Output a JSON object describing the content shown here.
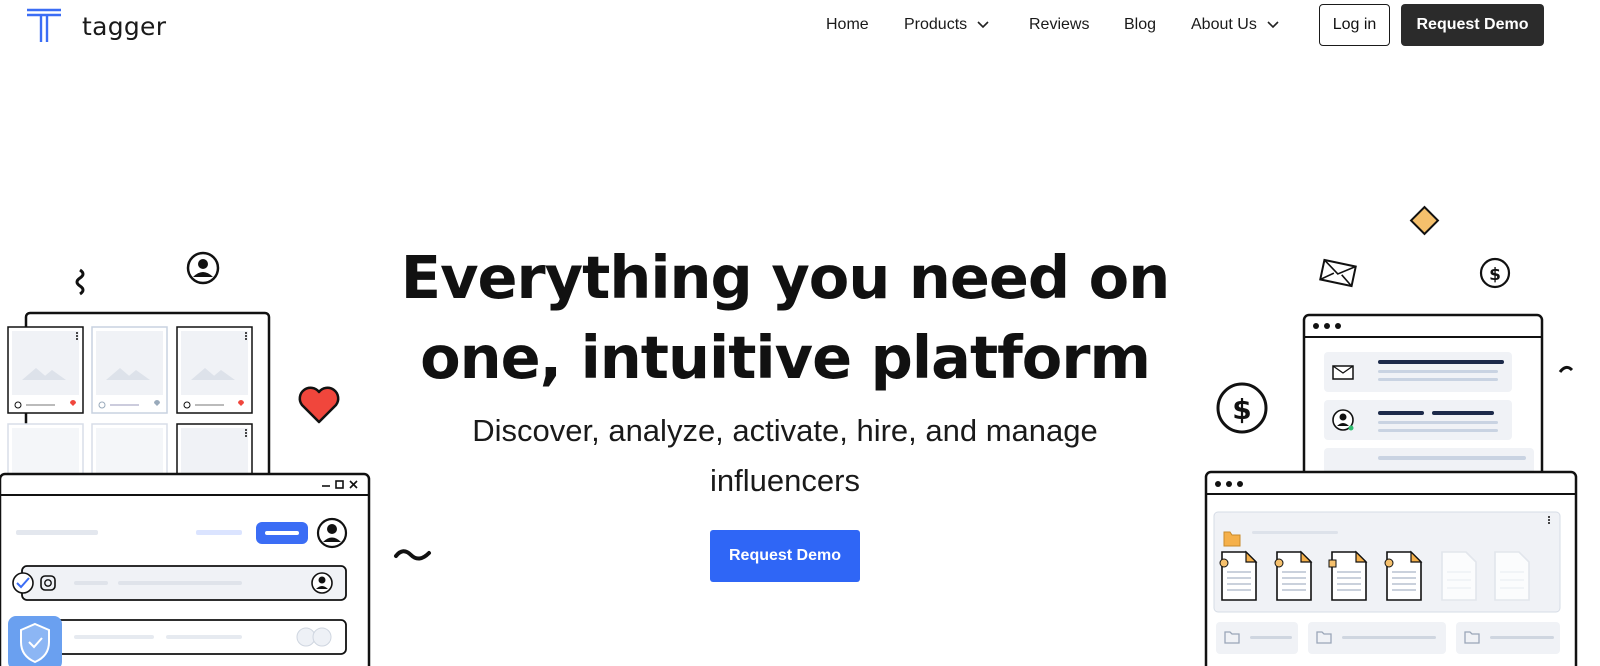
{
  "brand": {
    "name": "tagger",
    "accent": "#2f66f6"
  },
  "nav": {
    "items": [
      {
        "label": "Home",
        "dropdown": false
      },
      {
        "label": "Products",
        "dropdown": true
      },
      {
        "label": "Reviews",
        "dropdown": false
      },
      {
        "label": "Blog",
        "dropdown": false
      },
      {
        "label": "About Us",
        "dropdown": true
      }
    ],
    "login_label": "Log in",
    "demo_label": "Request Demo"
  },
  "hero": {
    "title_line1": "Everything you need on",
    "title_line2": "one, intuitive platform",
    "subtitle_line1": "Discover, analyze, activate, hire, and manage",
    "subtitle_line2": "influencers",
    "cta_label": "Request Demo"
  },
  "icons": [
    "menu-dots-icon",
    "heart-icon",
    "dollar-icon",
    "mail-icon",
    "user-icon",
    "instagram-icon",
    "check-icon",
    "shield-icon",
    "folder-icon",
    "document-icon",
    "diamond-icon"
  ],
  "colors": {
    "heart": "#f0463c",
    "diamond": "#f5c06c",
    "folder": "#f5b04a",
    "dark_button": "#2b2b2b"
  }
}
